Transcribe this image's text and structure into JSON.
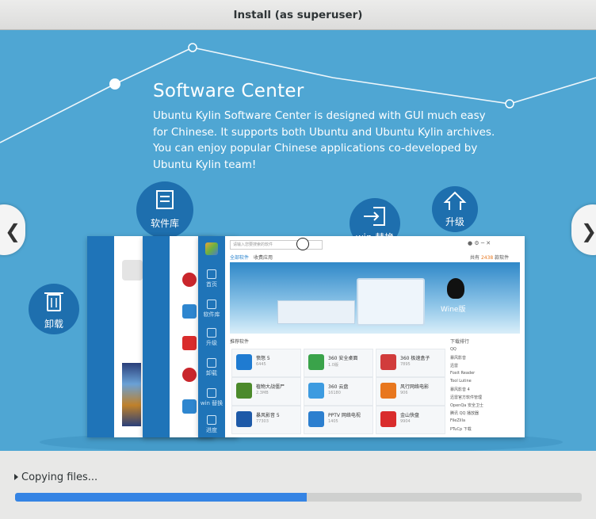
{
  "window": {
    "title": "Install (as superuser)"
  },
  "slide": {
    "title": "Software Center",
    "description": "Ubuntu Kylin Software Center is designed with GUI much easy for Chinese. It supports both Ubuntu and Ubuntu Kylin archives. You can enjoy popular Chinese applications co-developed by Ubuntu Kylin team!",
    "prev_glyph": "❮",
    "next_glyph": "❯",
    "bubbles": {
      "store": "软件库",
      "upgrade": "升级",
      "uninstall": "卸载",
      "win": "win 替换"
    },
    "colors": {
      "background": "#4fa6d3",
      "bubble": "#1e6fae",
      "sidebar": "#1f74b8"
    }
  },
  "app_window": {
    "search_placeholder": "请输入您要搜索的软件",
    "counter_label": "共有",
    "counter_value": "2438",
    "counter_unit": "款软件",
    "tabs": [
      "全部软件",
      "收费应用"
    ],
    "section_apps": "推荐软件",
    "section_rank": "下载排行",
    "banner_label": "Wine版",
    "sidebar": [
      "首页",
      "软件库",
      "升级",
      "卸载",
      "win 替换",
      "进度"
    ],
    "apps": [
      {
        "name": "愤怒 5",
        "sub": "6445",
        "color": "#1f7bd1"
      },
      {
        "name": "360 安全桌面",
        "sub": "1.0版",
        "color": "#3aa34a"
      },
      {
        "name": "360 极速盒子",
        "sub": "7895",
        "color": "#d13c3c"
      },
      {
        "name": "植物大战僵尸",
        "sub": "2.3MB",
        "color": "#4c8a2b"
      },
      {
        "name": "360 云盘",
        "sub": "16180",
        "color": "#3d9be0"
      },
      {
        "name": "风行网络电影",
        "sub": "906",
        "color": "#e8771e"
      },
      {
        "name": "暴风影音 5",
        "sub": "77303",
        "color": "#1e5aa8"
      },
      {
        "name": "PPTV 网络电视",
        "sub": "1405",
        "color": "#2c7fcf"
      },
      {
        "name": "金山快盘",
        "sub": "9904",
        "color": "#d92c2c"
      }
    ],
    "rank": [
      "QQ",
      "暴风影音",
      "迅雷",
      "Foxit Reader",
      "Tool Lutine",
      "暴风影音 4",
      "迅雷官方软件管理",
      "OpenQa 安全卫士",
      "腾讯 QQ 播放器",
      "FileZilla",
      "PTuCp 下载"
    ]
  },
  "footer": {
    "status": "Copying files...",
    "progress": 0.514,
    "progress_color": "#3584e4"
  }
}
